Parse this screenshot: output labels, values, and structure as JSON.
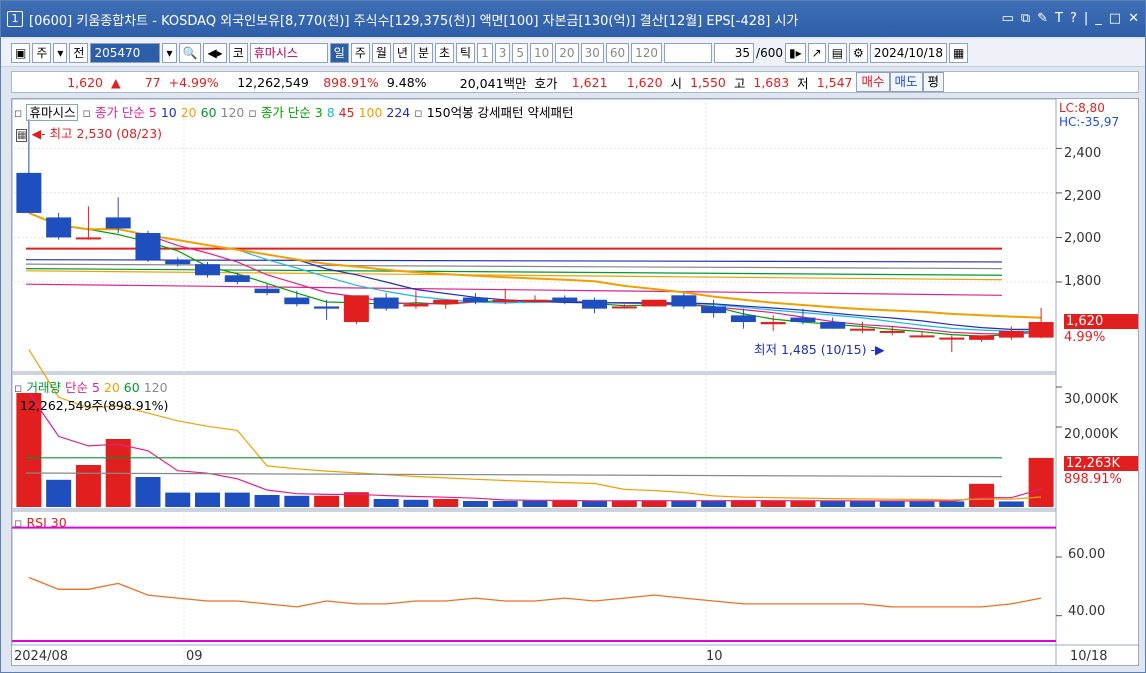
{
  "title": {
    "tab_number": "1",
    "text": "[0600] 키움종합차트 - KOSDAQ 외국인보유[8,770(천)] 주식수[129,375(천)] 액면[100] 자본금[130(억)] 결산[12월] EPS[-428] 시가",
    "icons": [
      "window-icon",
      "copy-icon",
      "link-icon",
      "T",
      "?",
      "|",
      "minimize",
      "maximize",
      "close"
    ]
  },
  "toolbar": {
    "mode_label": "주",
    "prev_label": "전",
    "code": "205470",
    "stock_prefix": "코",
    "stock_name": "휴마시스",
    "periods": [
      "일",
      "주",
      "월",
      "년",
      "분",
      "초",
      "틱"
    ],
    "period_selected": "일",
    "minutes": [
      "1",
      "3",
      "5",
      "10",
      "20",
      "30",
      "60",
      "120"
    ],
    "count_value": "35",
    "count_total": "/600",
    "date": "2024/10/18"
  },
  "quote": {
    "price": "1,620",
    "change": "77",
    "change_pct": "+4.99%",
    "volume": "12,262,549",
    "vol_ratio": "898.91%",
    "turnover": "9.48%",
    "amount": "20,041백만",
    "hoga_label": "호가",
    "ask": "1,621",
    "bid": "1,620",
    "open_label": "시",
    "open": "1,550",
    "high_label": "고",
    "high": "1,683",
    "low_label": "저",
    "low": "1,547",
    "buy_label": "매수",
    "sell_label": "매도",
    "eval_label": "평"
  },
  "price_panel": {
    "legend_name": "휴마시스",
    "ma_simple_label": "종가 단순",
    "ma_simple": [
      "5",
      "10",
      "20",
      "60",
      "120"
    ],
    "ma_simple_colors": [
      "#e0218a",
      "#1f2fbf",
      "#f0a000",
      "#009a30",
      "#888888"
    ],
    "ma_exp_label": "종가 단순",
    "ma_exp": [
      "3",
      "8",
      "45",
      "100",
      "224"
    ],
    "ma_exp_colors": [
      "#00a000",
      "#19b8e8",
      "#e21f1f",
      "#f0a000",
      "#1f2fbf"
    ],
    "extra": "150억봉 강세패턴",
    "extra2": "약세패턴",
    "high_note": "최고 2,530 (08/23)",
    "low_note": "최저 1,485 (10/15)",
    "lc": "LC:8,80",
    "hc": "HC:-35,97",
    "y_ticks": [
      "2,400",
      "2,200",
      "2,000",
      "1,800"
    ],
    "current_price": "1,620",
    "current_pct": "4.99%"
  },
  "volume_panel": {
    "legend_name": "거래량",
    "ma_label": "단순",
    "ma": [
      "5",
      "20",
      "60",
      "120"
    ],
    "ma_colors": [
      "#e0218a",
      "#f0a000",
      "#009a30",
      "#888888"
    ],
    "current_note": "12,262,549주(898.91%)",
    "y_ticks": [
      "30,000K",
      "20,000K"
    ],
    "current_vol": "12,263K",
    "current_pct": "898.91%"
  },
  "rsi_panel": {
    "legend_name": "RSI 30",
    "y_ticks": [
      "60.00",
      "40.00"
    ]
  },
  "x_axis": {
    "labels": [
      "2024/08",
      "09",
      "10",
      "10/18"
    ]
  },
  "chart_data": {
    "type": "candlestick",
    "title": "휴마시스",
    "dates_range": [
      "2024/08",
      "2024/10/18"
    ],
    "ylim": [
      1400,
      2550
    ],
    "candles": [
      {
        "o": 2290,
        "h": 2530,
        "l": 2120,
        "c": 2110
      },
      {
        "o": 2090,
        "h": 2110,
        "l": 1990,
        "c": 2000
      },
      {
        "o": 2000,
        "h": 2140,
        "l": 1990,
        "c": 2000
      },
      {
        "o": 2090,
        "h": 2180,
        "l": 2020,
        "c": 2040
      },
      {
        "o": 2020,
        "h": 2030,
        "l": 1890,
        "c": 1900
      },
      {
        "o": 1900,
        "h": 1910,
        "l": 1870,
        "c": 1880
      },
      {
        "o": 1880,
        "h": 1890,
        "l": 1820,
        "c": 1830
      },
      {
        "o": 1830,
        "h": 1840,
        "l": 1790,
        "c": 1800
      },
      {
        "o": 1770,
        "h": 1790,
        "l": 1740,
        "c": 1750
      },
      {
        "o": 1730,
        "h": 1760,
        "l": 1690,
        "c": 1700
      },
      {
        "o": 1690,
        "h": 1720,
        "l": 1630,
        "c": 1680
      },
      {
        "o": 1620,
        "h": 1740,
        "l": 1610,
        "c": 1740
      },
      {
        "o": 1730,
        "h": 1750,
        "l": 1670,
        "c": 1680
      },
      {
        "o": 1690,
        "h": 1760,
        "l": 1680,
        "c": 1700
      },
      {
        "o": 1700,
        "h": 1720,
        "l": 1680,
        "c": 1720
      },
      {
        "o": 1730,
        "h": 1750,
        "l": 1700,
        "c": 1710
      },
      {
        "o": 1710,
        "h": 1770,
        "l": 1700,
        "c": 1720
      },
      {
        "o": 1720,
        "h": 1740,
        "l": 1710,
        "c": 1720
      },
      {
        "o": 1730,
        "h": 1740,
        "l": 1700,
        "c": 1710
      },
      {
        "o": 1720,
        "h": 1730,
        "l": 1660,
        "c": 1680
      },
      {
        "o": 1690,
        "h": 1700,
        "l": 1680,
        "c": 1690
      },
      {
        "o": 1690,
        "h": 1720,
        "l": 1690,
        "c": 1720
      },
      {
        "o": 1740,
        "h": 1750,
        "l": 1680,
        "c": 1690
      },
      {
        "o": 1690,
        "h": 1720,
        "l": 1640,
        "c": 1660
      },
      {
        "o": 1650,
        "h": 1680,
        "l": 1590,
        "c": 1620
      },
      {
        "o": 1610,
        "h": 1650,
        "l": 1580,
        "c": 1620
      },
      {
        "o": 1640,
        "h": 1680,
        "l": 1610,
        "c": 1620
      },
      {
        "o": 1620,
        "h": 1640,
        "l": 1590,
        "c": 1590
      },
      {
        "o": 1590,
        "h": 1620,
        "l": 1570,
        "c": 1590
      },
      {
        "o": 1580,
        "h": 1600,
        "l": 1560,
        "c": 1580
      },
      {
        "o": 1560,
        "h": 1580,
        "l": 1550,
        "c": 1560
      },
      {
        "o": 1550,
        "h": 1560,
        "l": 1485,
        "c": 1550
      },
      {
        "o": 1540,
        "h": 1560,
        "l": 1530,
        "c": 1560
      },
      {
        "o": 1550,
        "h": 1600,
        "l": 1540,
        "c": 1580
      },
      {
        "o": 1550,
        "h": 1683,
        "l": 1547,
        "c": 1620
      }
    ],
    "volume_k": [
      28500,
      6800,
      10500,
      17000,
      7500,
      3600,
      3600,
      3600,
      3000,
      2800,
      2800,
      3700,
      2000,
      1800,
      2000,
      1500,
      1500,
      1600,
      1600,
      1600,
      1600,
      1500,
      1600,
      1600,
      1700,
      1500,
      1500,
      1500,
      1500,
      1500,
      1500,
      1400,
      5800,
      1400,
      12263
    ],
    "volume_up": [
      true,
      false,
      true,
      true,
      false,
      false,
      false,
      false,
      false,
      false,
      true,
      true,
      false,
      false,
      true,
      false,
      false,
      false,
      true,
      false,
      true,
      true,
      false,
      false,
      true,
      true,
      true,
      false,
      false,
      false,
      false,
      false,
      true,
      false,
      true
    ],
    "rsi": [
      53,
      49,
      49,
      51,
      47,
      46,
      45,
      45,
      44,
      43,
      45,
      44,
      44,
      45,
      45,
      46,
      45,
      45,
      46,
      45,
      46,
      47,
      46,
      45,
      44,
      44,
      44,
      44,
      44,
      43,
      43,
      43,
      43,
      44,
      46
    ],
    "hlines_price": [
      1950,
      1900,
      1880,
      1860,
      1850,
      1790
    ]
  }
}
